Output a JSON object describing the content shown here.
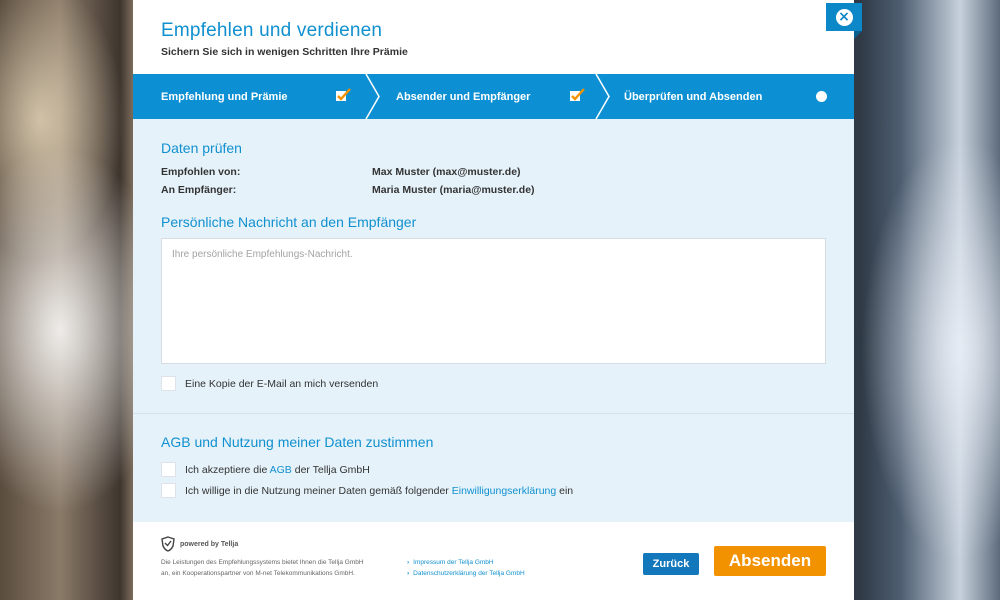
{
  "header": {
    "title": "Empfehlen und verdienen",
    "subtitle": "Sichern Sie sich in wenigen Schritten Ihre Prämie"
  },
  "steps": [
    {
      "label": "Empfehlung und Prämie",
      "status": "done"
    },
    {
      "label": "Absender und Empfänger",
      "status": "done"
    },
    {
      "label": "Überprüfen und Absenden",
      "status": "current"
    }
  ],
  "review": {
    "title": "Daten prüfen",
    "from_label": "Empfohlen von:",
    "from_value": "Max Muster (max@muster.de)",
    "to_label": "An Empfänger:",
    "to_value": "Maria Muster (maria@muster.de)"
  },
  "message": {
    "title": "Persönliche Nachricht an den Empfänger",
    "placeholder": "Ihre persönliche Empfehlungs-Nachricht.",
    "copy_label": "Eine Kopie der E-Mail an mich versenden"
  },
  "consent": {
    "title": "AGB und Nutzung meiner Daten zustimmen",
    "agb_prefix": "Ich akzeptiere die ",
    "agb_link": "AGB",
    "agb_suffix": " der Tellja GmbH",
    "data_prefix": "Ich willige in die Nutzung meiner Daten gemäß folgender ",
    "data_link": "Einwilligungserklärung",
    "data_suffix": " ein"
  },
  "footer": {
    "powered": "powered by Tellja",
    "text_line1": "Die Leistungen des Empfehlungssystems bietet Ihnen die Tellja GmbH",
    "text_line2": "an, ein Kooperationspartner von M-net Telekommunikations GmbH.",
    "link_imprint": "Impressum der Tellja GmbH",
    "link_privacy": "Datenschutzerklärung der Tellja GmbH"
  },
  "buttons": {
    "back": "Zurück",
    "send": "Absenden",
    "close_icon": "close-icon"
  },
  "colors": {
    "primary": "#1190cf",
    "accent": "#f39200",
    "panel": "#e5f2fa"
  }
}
